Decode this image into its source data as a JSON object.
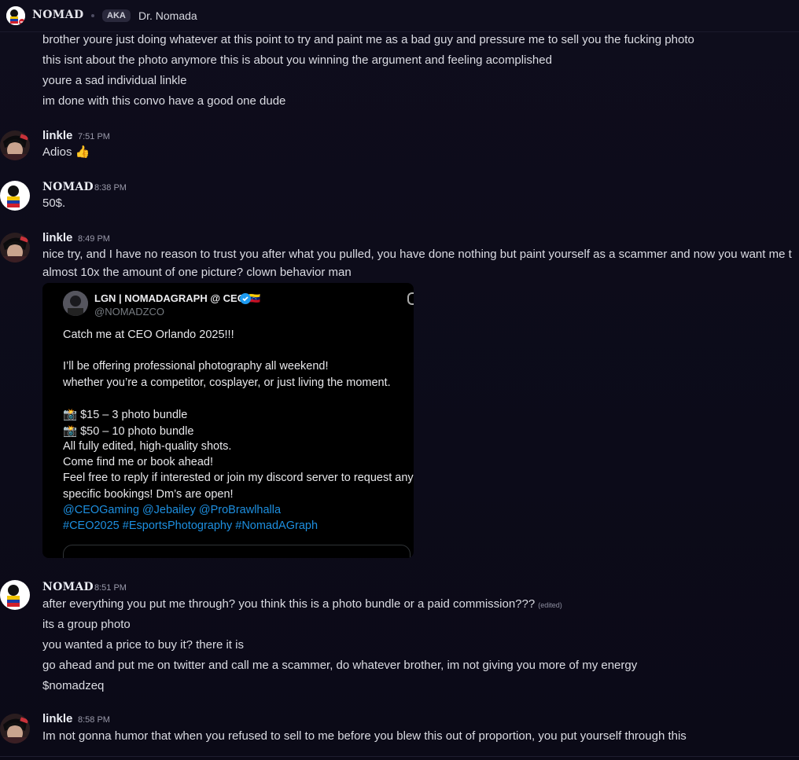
{
  "header": {
    "name": "NOMAD",
    "aka_badge": "AKA",
    "nickname": "Dr. Nomada"
  },
  "intro_lines": [
    "brother youre just doing whatever at this point to try and paint me as a bad guy and pressure me to sell you the fucking photo",
    "this isnt about the photo anymore this is about you winning the argument and feeling acomplished",
    "youre a sad individual linkle",
    "im done with this convo have a good one dude"
  ],
  "messages": [
    {
      "author": "linkle",
      "time": "7:51 PM",
      "lines": [
        "Adios 👍"
      ]
    },
    {
      "author": "NOMAD",
      "time": "8:38 PM",
      "lines": [
        "50$."
      ]
    },
    {
      "author": "linkle",
      "time": "8:49 PM",
      "lines": [
        "nice try, and I have no reason to trust you after what you pulled, you have done nothing but paint yourself as a scammer and now you want me t",
        "almost 10x the amount of one picture? clown behavior man"
      ]
    },
    {
      "author": "NOMAD",
      "time": "8:51 PM",
      "edited": "(edited)",
      "lines": [
        "after everything you put me through? you think this is a photo bundle or a paid commission???",
        "its a group photo",
        "you wanted a price to buy it? there it is",
        "go ahead and put me on twitter and call me a scammer, do whatever brother, im not giving you more of my energy",
        "$nomadzeq"
      ]
    },
    {
      "author": "linkle",
      "time": "8:58 PM",
      "lines": [
        "Im not gonna humor that when you refused to sell to me before you blew this out of proportion, you put yourself through this"
      ]
    }
  ],
  "embed": {
    "display_name": "LGN | NOMADAGRAPH @ CEO 🇻🇪",
    "handle": "@NOMADZCO",
    "lines": [
      "Catch me at CEO Orlando 2025!!!",
      "I’ll be offering professional photography all weekend!",
      "whether you’re a competitor, cosplayer, or just living the moment.",
      "📸 $15 – 3 photo bundle",
      "📸 $50 – 10 photo bundle",
      "All fully edited, high-quality shots.",
      "Come find me or book ahead!",
      "Feel free to reply if interested or join my discord server to request any",
      "specific bookings! Dm’s are open!"
    ],
    "mentions": "@CEOGaming @Jebailey @ProBrawlhalla",
    "hashtags": "#CEO2025 #EsportsPhotography #NomadAGraph"
  },
  "colors": {
    "background": "#0d0c1a",
    "link_blue": "#1d8fe0",
    "verified_blue": "#1d9bf0"
  }
}
